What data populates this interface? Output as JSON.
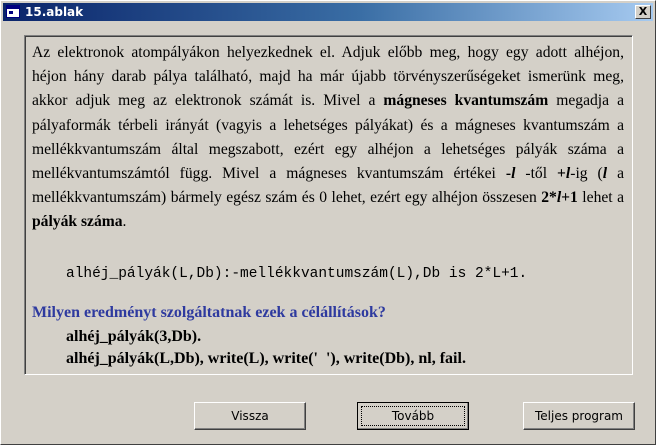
{
  "window": {
    "title": "15.ablak",
    "close_label": "X"
  },
  "paragraph": [
    {
      "text": "Az elektronok atompályákon helyezkednek el. Adjuk előbb meg, hogy egy adott alhéjon, héjon hány darab pálya található, majd ha már újabb törvényszerűsége­ket ismerünk meg, akkor adjuk meg az elektronok számát is. Mivel a ",
      "style": "normal"
    },
    {
      "text": "mágneses kvantumszám",
      "style": "bold"
    },
    {
      "text": " megadja a pályaformák térbeli irányát (vagyis a lehetséges pályákat) és a mágneses kvantumszám a mellékkvantumszám által megszabott, ezért egy alhéjon a lehetséges pályák száma a mellékvantumszámtól függ. Mivel a mágneses kvantumszám értékei ",
      "style": "normal"
    },
    {
      "text": "-",
      "style": "bold"
    },
    {
      "text": "l",
      "style": "bolditalic"
    },
    {
      "text": " -től ",
      "style": "normal"
    },
    {
      "text": "+",
      "style": "bold"
    },
    {
      "text": "l",
      "style": "bolditalic"
    },
    {
      "text": "-ig (",
      "style": "normal"
    },
    {
      "text": "l",
      "style": "bolditalic"
    },
    {
      "text": " a mellékkvantumszám) bármely egész szám és 0 lehet, ezért egy alhéjon összesen ",
      "style": "normal"
    },
    {
      "text": "2*",
      "style": "bold"
    },
    {
      "text": "l",
      "style": "bolditalic"
    },
    {
      "text": "+1",
      "style": "bold"
    },
    {
      "text": " lehet a ",
      "style": "normal"
    },
    {
      "text": "pályák száma",
      "style": "bold"
    },
    {
      "text": ".",
      "style": "normal"
    }
  ],
  "code": "alhéj_pályák(L,Db):-mellékkvantumszám(L),Db is 2*L+1.",
  "question": "Milyen eredményt szolgáltatnak ezek a célállítások?",
  "queries": [
    "alhéj_pályák(3,Db).",
    "alhéj_pályák(L,Db), write(L), write('  '), write(Db), nl, fail."
  ],
  "buttons": {
    "back": "Vissza",
    "next": "Tovább",
    "full": "Teljes program"
  },
  "colors": {
    "question": "#2e3a9f",
    "titlebar": "#0a246a"
  }
}
